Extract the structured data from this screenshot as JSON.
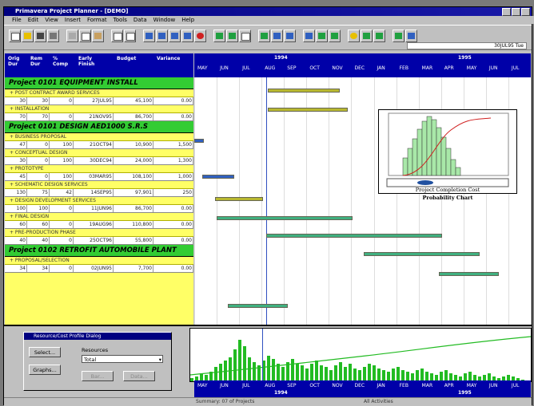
{
  "window": {
    "title": "Primavera Project Planner - [DEMO]"
  },
  "menu": [
    "File",
    "Edit",
    "View",
    "Insert",
    "Format",
    "Tools",
    "Data",
    "Window",
    "Help"
  ],
  "toolbar": {
    "status_text": "30JUL95 Tue"
  },
  "columns": [
    "Orig Dur",
    "Rem Dur",
    "% Comp",
    "Early Finish",
    "Budget",
    "Variance"
  ],
  "projects": [
    {
      "name": "Project 0101 EQUIPMENT INSTALL",
      "tasks": [
        {
          "name": "+ POST CONTRACT AWARD SERVICES",
          "values": [
            "30",
            "30",
            "0",
            "27JUL95",
            "45,100",
            "0.00"
          ]
        },
        {
          "name": "+ INSTALLATION",
          "values": [
            "70",
            "70",
            "0",
            "21NOV95",
            "86,700",
            "0.00"
          ]
        }
      ]
    },
    {
      "name": "Project 0101 DESIGN AED1000 S.R.S",
      "tasks": [
        {
          "name": "+ BUSINESS PROPOSAL",
          "values": [
            "47",
            "0",
            "100",
            "21OCT94",
            "10,900",
            "1,500"
          ]
        },
        {
          "name": "+ CONCEPTUAL DESIGN",
          "values": [
            "30",
            "0",
            "100",
            "30DEC94",
            "24,000",
            "1,300"
          ]
        },
        {
          "name": "+ PROTOTYPE",
          "values": [
            "45",
            "0",
            "100",
            "03MAR95",
            "108,100",
            "1,000"
          ]
        },
        {
          "name": "+ SCHEMATIC DESIGN SERVICES",
          "values": [
            "130",
            "75",
            "42",
            "14SEP95",
            "97,901",
            "250"
          ]
        },
        {
          "name": "+ DESIGN DEVELOPMENT SERVICES",
          "values": [
            "100",
            "100",
            "0",
            "11JUN96",
            "86,700",
            "0.00"
          ]
        },
        {
          "name": "+ FINAL DESIGN",
          "values": [
            "60",
            "60",
            "0",
            "19AUG96",
            "110,800",
            "0.00"
          ]
        },
        {
          "name": "+ PRE-PRODUCTION PHASE",
          "values": [
            "40",
            "40",
            "0",
            "25OCT96",
            "55,800",
            "0.00"
          ]
        }
      ]
    },
    {
      "name": "Project 0102 RETROFIT AUTOMOBILE PLANT",
      "tasks": [
        {
          "name": "+ PROPOSAL/SELECTION",
          "values": [
            "34",
            "34",
            "0",
            "02JUN95",
            "7,700",
            "0.00"
          ]
        }
      ]
    }
  ],
  "gantt": {
    "years": [
      "1994",
      "1995"
    ],
    "months": [
      "MAY",
      "JUN",
      "JUL",
      "AUG",
      "SEP",
      "OCT",
      "NOV",
      "DEC",
      "JAN",
      "FEB",
      "MAR",
      "APR",
      "MAY",
      "JUN",
      "JUL"
    ]
  },
  "inset": {
    "caption_line1": "Project Completion Cost",
    "caption_line2": "Probability Chart"
  },
  "dialog": {
    "title": "Resource/Cost Profile Dialog",
    "select_label": "Select...",
    "graphs_label": "Graphs...",
    "resources_label": "Resources",
    "resource_value": "Total",
    "btn3": "Bar...",
    "btn4": "Data..."
  },
  "status": {
    "left": "",
    "mid": "Summary: 07 of Projects",
    "right": "All Activities"
  },
  "colors": {
    "navy": "#0000a8",
    "project_green": "#33cc33",
    "task_yellow": "#ffff66",
    "histogram_green": "#22bb22"
  }
}
